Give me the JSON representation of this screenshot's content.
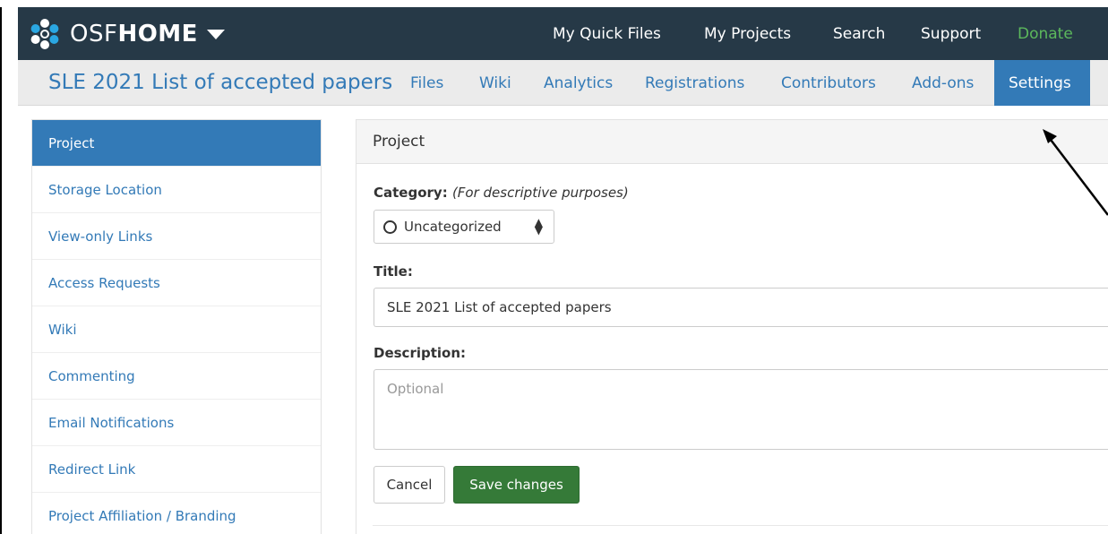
{
  "topbar": {
    "brand_prefix": "OSF",
    "brand_bold": "HOME",
    "links": [
      "My Quick Files",
      "My Projects",
      "Search",
      "Support",
      "Donate"
    ],
    "link_colors": [
      "#ffffff",
      "#ffffff",
      "#ffffff",
      "#ffffff",
      "#5cb85c"
    ]
  },
  "project": {
    "title": "SLE 2021 List of accepted papers",
    "nav": [
      "Files",
      "Wiki",
      "Analytics",
      "Registrations",
      "Contributors",
      "Add-ons",
      "Settings"
    ],
    "active_nav": "Settings"
  },
  "sidebar": {
    "items": [
      "Project",
      "Storage Location",
      "View-only Links",
      "Access Requests",
      "Wiki",
      "Commenting",
      "Email Notifications",
      "Redirect Link",
      "Project Affiliation / Branding"
    ],
    "active": "Project"
  },
  "panel": {
    "heading": "Project",
    "category_label": "Category:",
    "category_hint": "(For descriptive purposes)",
    "category_value": "Uncategorized",
    "title_label": "Title:",
    "title_value": "SLE 2021 List of accepted papers",
    "description_label": "Description:",
    "description_placeholder": "Optional",
    "cancel_label": "Cancel",
    "save_label": "Save changes"
  },
  "colors": {
    "navbar": "#263947",
    "primary": "#337ab7",
    "success": "#357a38",
    "donate": "#5cb85c"
  },
  "icons": {
    "brand": "osf-logo-icon",
    "caret": "caret-down-icon",
    "category": "circle-outline-icon",
    "select": "sort-arrows-icon",
    "annotation": "arrow-icon"
  }
}
